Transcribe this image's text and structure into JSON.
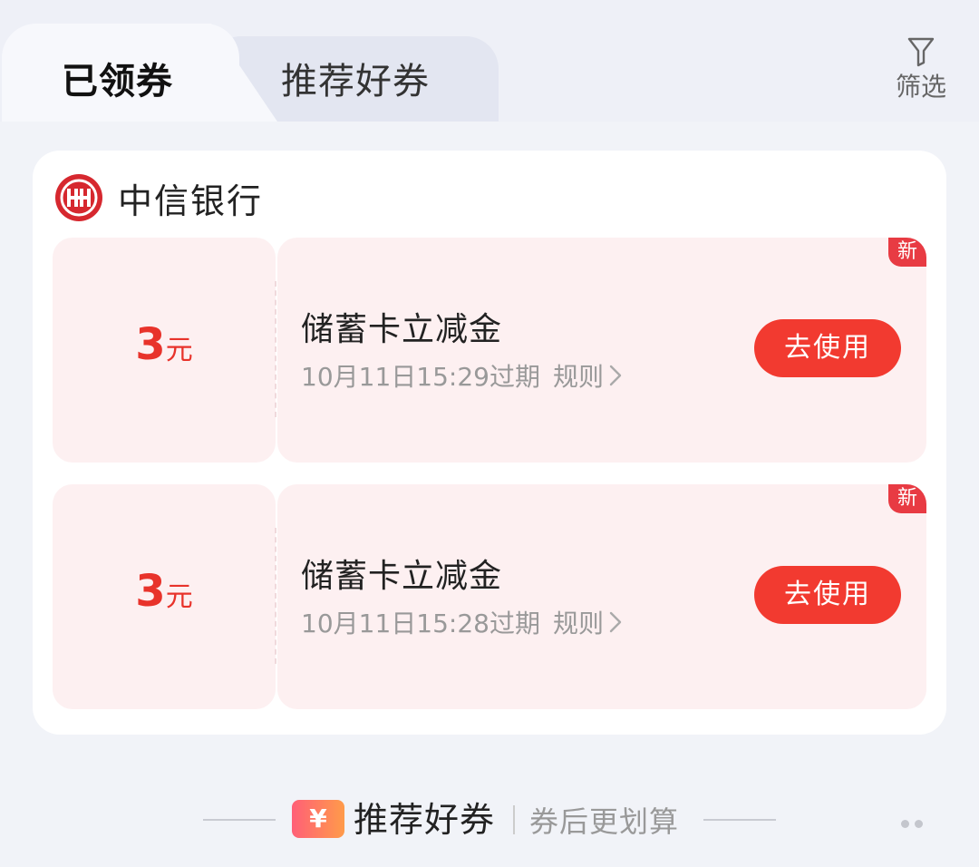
{
  "tabs": {
    "active_label": "已领券",
    "inactive_label": "推荐好券"
  },
  "filter": {
    "label": "筛选",
    "icon": "filter-funnel-icon"
  },
  "bank": {
    "name": "中信银行",
    "logo_icon": "citic-bank-logo"
  },
  "coupons": [
    {
      "amount": "3",
      "unit": "元",
      "title": "储蓄卡立减金",
      "expiry": "10月11日15:29过期",
      "rule_label": "规则",
      "button_label": "去使用",
      "badge": "新"
    },
    {
      "amount": "3",
      "unit": "元",
      "title": "储蓄卡立减金",
      "expiry": "10月11日15:28过期",
      "rule_label": "规则",
      "button_label": "去使用",
      "badge": "新"
    }
  ],
  "recommend": {
    "icon_text": "¥",
    "title": "推荐好券",
    "subtitle": "券后更划算"
  },
  "colors": {
    "accent_red": "#f23a30",
    "coupon_bg": "#fdf0f1",
    "badge_red": "#e83b43",
    "page_bg": "#eef0f7"
  }
}
